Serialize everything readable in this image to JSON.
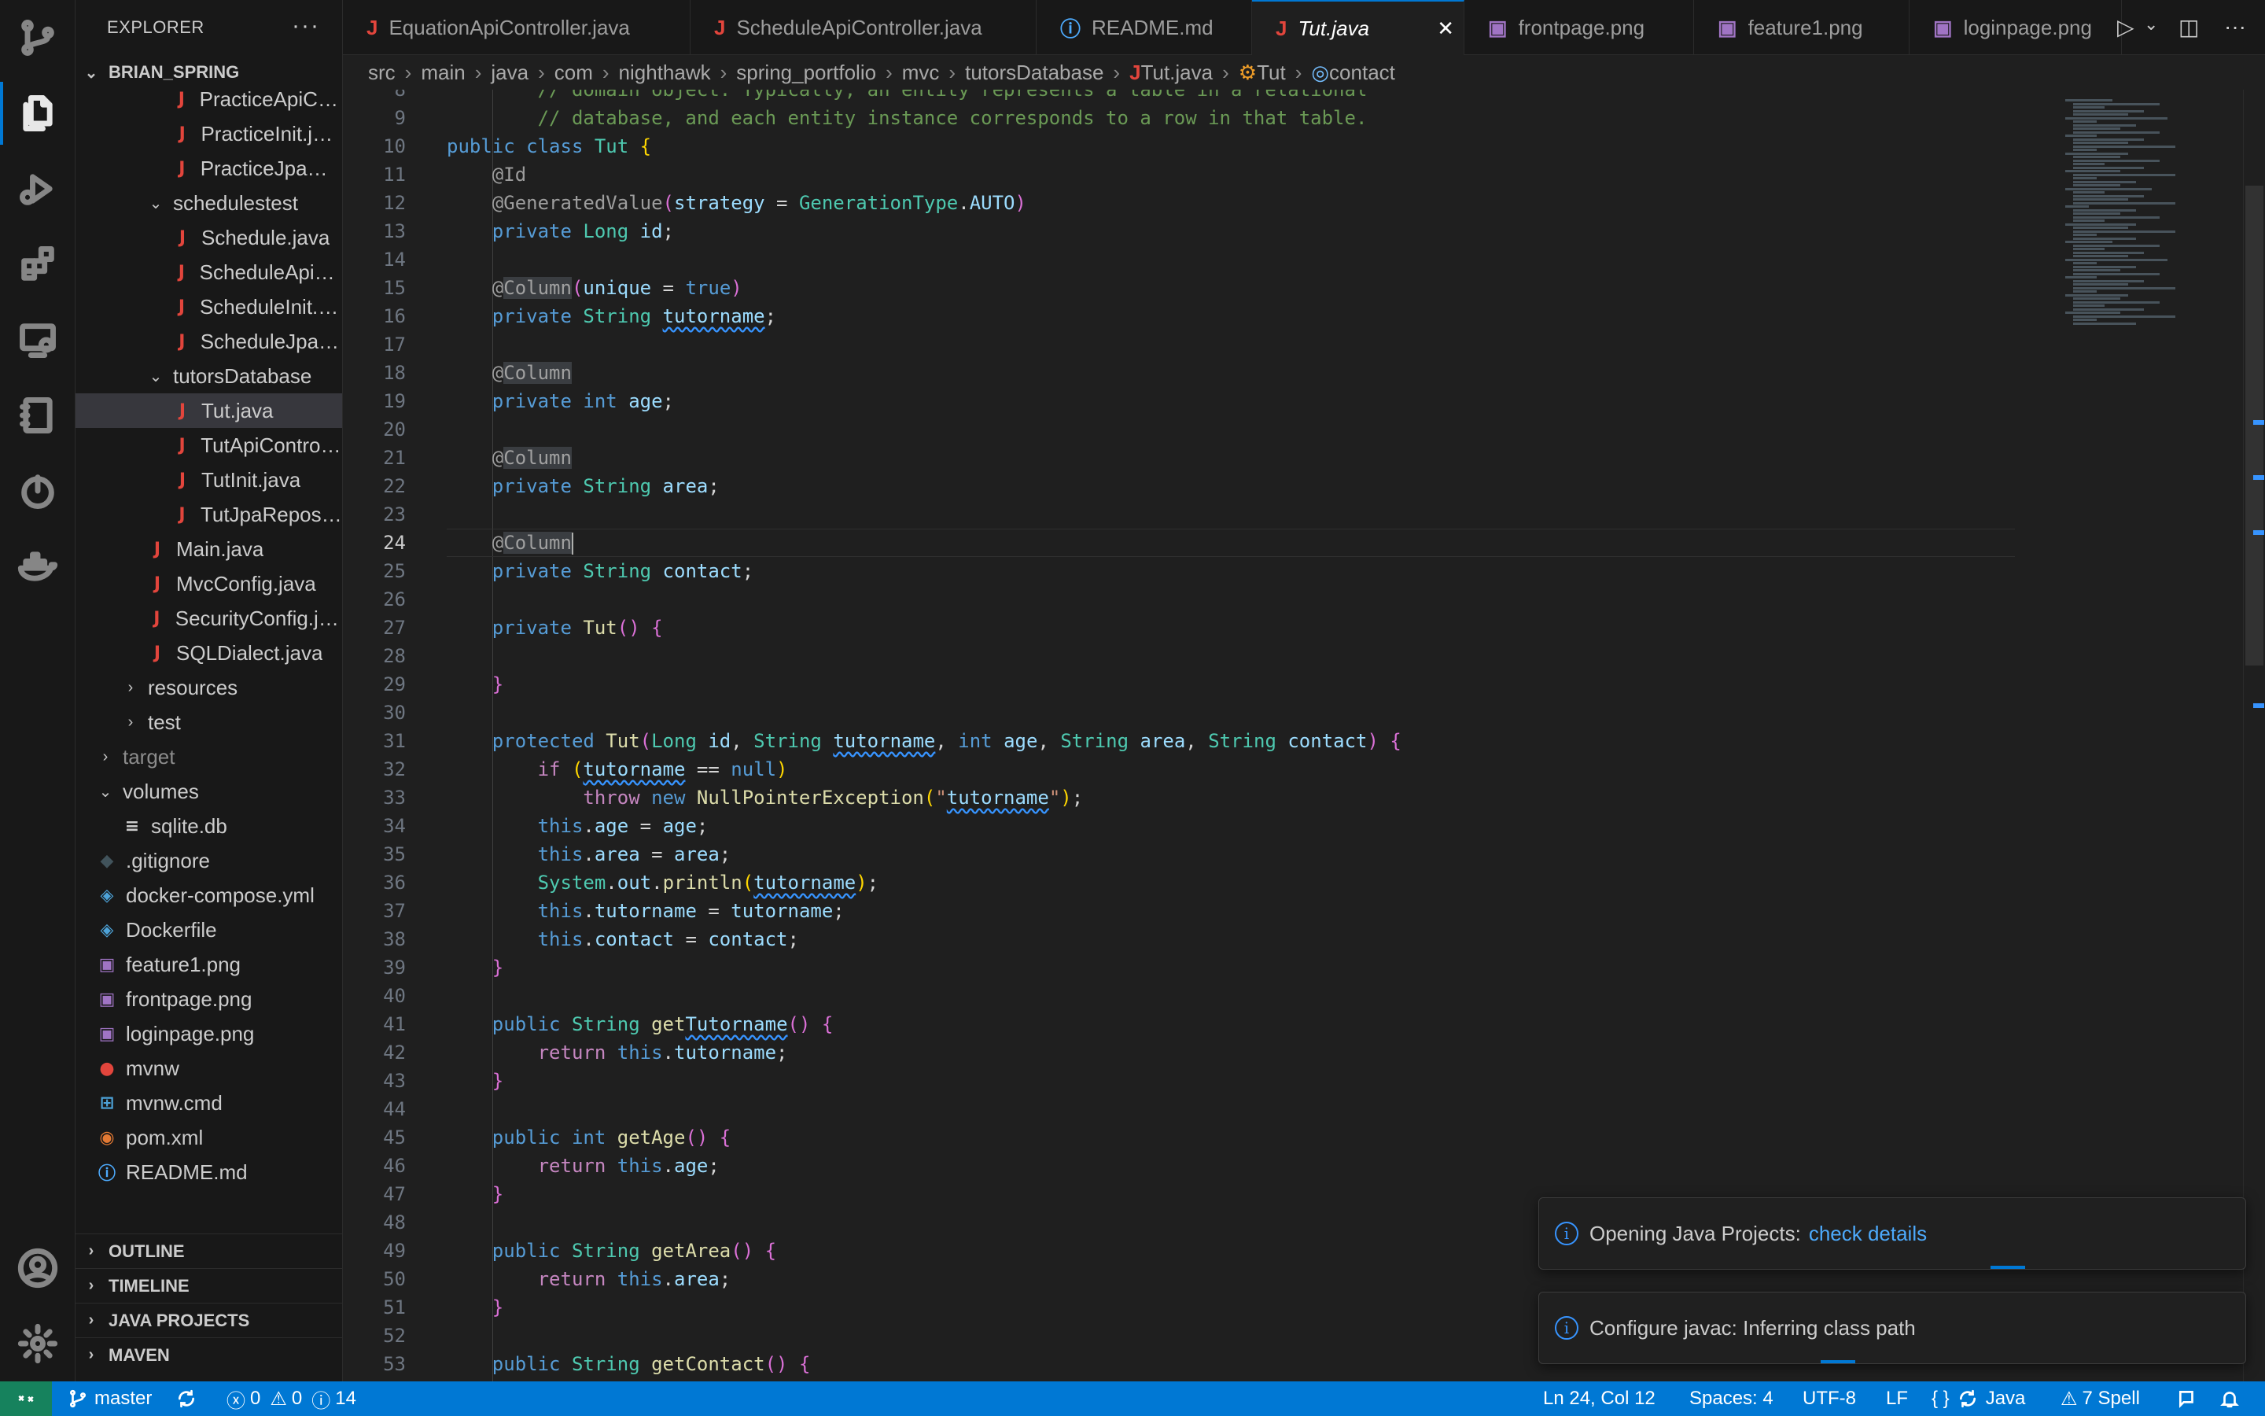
{
  "sidebar": {
    "title": "EXPLORER",
    "root": "BRIAN_SPRING",
    "items": [
      {
        "label": "PracticeApiCon...",
        "indent": 3,
        "icon": "java",
        "kind": "file"
      },
      {
        "label": "PracticeInit.java",
        "indent": 3,
        "icon": "java",
        "kind": "file"
      },
      {
        "label": "PracticeJpaRe...",
        "indent": 3,
        "icon": "java",
        "kind": "file"
      },
      {
        "label": "schedulestest",
        "indent": 2,
        "icon": "",
        "kind": "folder-open"
      },
      {
        "label": "Schedule.java",
        "indent": 3,
        "icon": "java",
        "kind": "file"
      },
      {
        "label": "ScheduleApiCo...",
        "indent": 3,
        "icon": "java",
        "kind": "file"
      },
      {
        "label": "ScheduleInit.java",
        "indent": 3,
        "icon": "java",
        "kind": "file"
      },
      {
        "label": "ScheduleJpaR...",
        "indent": 3,
        "icon": "java",
        "kind": "file"
      },
      {
        "label": "tutorsDatabase",
        "indent": 2,
        "icon": "",
        "kind": "folder-open"
      },
      {
        "label": "Tut.java",
        "indent": 3,
        "icon": "java",
        "kind": "file",
        "selected": true
      },
      {
        "label": "TutApiControll...",
        "indent": 3,
        "icon": "java",
        "kind": "file"
      },
      {
        "label": "TutInit.java",
        "indent": 3,
        "icon": "java",
        "kind": "file"
      },
      {
        "label": "TutJpaReposit...",
        "indent": 3,
        "icon": "java",
        "kind": "file"
      },
      {
        "label": "Main.java",
        "indent": 2,
        "icon": "java",
        "kind": "file"
      },
      {
        "label": "MvcConfig.java",
        "indent": 2,
        "icon": "java",
        "kind": "file"
      },
      {
        "label": "SecurityConfig.java",
        "indent": 2,
        "icon": "java",
        "kind": "file"
      },
      {
        "label": "SQLDialect.java",
        "indent": 2,
        "icon": "java",
        "kind": "file"
      },
      {
        "label": "resources",
        "indent": 1,
        "icon": "",
        "kind": "folder-closed"
      },
      {
        "label": "test",
        "indent": 1,
        "icon": "",
        "kind": "folder-closed"
      },
      {
        "label": "target",
        "indent": 0,
        "icon": "",
        "kind": "folder-closed",
        "dim": true
      },
      {
        "label": "volumes",
        "indent": 0,
        "icon": "",
        "kind": "folder-open"
      },
      {
        "label": "sqlite.db",
        "indent": 1,
        "icon": "db",
        "kind": "file"
      },
      {
        "label": ".gitignore",
        "indent": 0,
        "icon": "git",
        "kind": "file"
      },
      {
        "label": "docker-compose.yml",
        "indent": 0,
        "icon": "docker",
        "kind": "file"
      },
      {
        "label": "Dockerfile",
        "indent": 0,
        "icon": "docker",
        "kind": "file"
      },
      {
        "label": "feature1.png",
        "indent": 0,
        "icon": "image",
        "kind": "file"
      },
      {
        "label": "frontpage.png",
        "indent": 0,
        "icon": "image",
        "kind": "file"
      },
      {
        "label": "loginpage.png",
        "indent": 0,
        "icon": "image",
        "kind": "file"
      },
      {
        "label": "mvnw",
        "indent": 0,
        "icon": "pin",
        "kind": "file"
      },
      {
        "label": "mvnw.cmd",
        "indent": 0,
        "icon": "windows",
        "kind": "file"
      },
      {
        "label": "pom.xml",
        "indent": 0,
        "icon": "rss",
        "kind": "file"
      },
      {
        "label": "README.md",
        "indent": 0,
        "icon": "info",
        "kind": "file"
      }
    ],
    "sections": [
      "OUTLINE",
      "TIMELINE",
      "JAVA PROJECTS",
      "MAVEN"
    ]
  },
  "tabs": [
    {
      "label": "EquationApiController.java",
      "icon": "java"
    },
    {
      "label": "ScheduleApiController.java",
      "icon": "java"
    },
    {
      "label": "README.md",
      "icon": "info"
    },
    {
      "label": "Tut.java",
      "icon": "java",
      "active": true
    },
    {
      "label": "frontpage.png",
      "icon": "image"
    },
    {
      "label": "feature1.png",
      "icon": "image"
    },
    {
      "label": "loginpage.png",
      "icon": "image"
    }
  ],
  "breadcrumb": [
    "src",
    "main",
    "java",
    "com",
    "nighthawk",
    "spring_portfolio",
    "mvc",
    "tutorsDatabase",
    "Tut.java",
    "Tut",
    "contact"
  ],
  "editor": {
    "first_line": 8,
    "current_line": 24,
    "lines": [
      [
        [
          "cm",
          "        // domain object. Typically, an entity represents a table in a relational"
        ]
      ],
      [
        [
          "cm",
          "        // database, and each entity instance corresponds to a row in that table."
        ]
      ],
      [
        [
          "kw",
          "public "
        ],
        [
          "kw",
          "class "
        ],
        [
          "ty",
          "Tut "
        ],
        [
          "br",
          "{"
        ]
      ],
      [
        [
          "an",
          "    @Id"
        ]
      ],
      [
        [
          "an",
          "    @GeneratedValue"
        ],
        [
          "br2",
          "("
        ],
        [
          "va",
          "strategy"
        ],
        [
          "pu",
          " = "
        ],
        [
          "ty",
          "GenerationType"
        ],
        [
          "pu",
          "."
        ],
        [
          "va",
          "AUTO"
        ],
        [
          "br2",
          ")"
        ]
      ],
      [
        [
          "kw",
          "    private "
        ],
        [
          "ty",
          "Long "
        ],
        [
          "va",
          "id"
        ],
        [
          "pu",
          ";"
        ]
      ],
      [
        [
          "pu",
          ""
        ]
      ],
      [
        [
          "an",
          "    @"
        ],
        [
          "anh",
          "Column"
        ],
        [
          "br2",
          "("
        ],
        [
          "va",
          "unique"
        ],
        [
          "pu",
          " = "
        ],
        [
          "kw",
          "true"
        ],
        [
          "br2",
          ")"
        ]
      ],
      [
        [
          "kw",
          "    private "
        ],
        [
          "ty",
          "String "
        ],
        [
          "sq",
          "tutorname"
        ],
        [
          "pu",
          ";"
        ]
      ],
      [
        [
          "pu",
          ""
        ]
      ],
      [
        [
          "an",
          "    @"
        ],
        [
          "anh",
          "Column"
        ]
      ],
      [
        [
          "kw",
          "    private "
        ],
        [
          "kw",
          "int "
        ],
        [
          "va",
          "age"
        ],
        [
          "pu",
          ";"
        ]
      ],
      [
        [
          "pu",
          ""
        ]
      ],
      [
        [
          "an",
          "    @"
        ],
        [
          "anh",
          "Column"
        ]
      ],
      [
        [
          "kw",
          "    private "
        ],
        [
          "ty",
          "String "
        ],
        [
          "va",
          "area"
        ],
        [
          "pu",
          ";"
        ]
      ],
      [
        [
          "pu",
          ""
        ]
      ],
      [
        [
          "an",
          "    @"
        ],
        [
          "anh",
          "Column"
        ],
        [
          "caret",
          ""
        ]
      ],
      [
        [
          "kw",
          "    private "
        ],
        [
          "ty",
          "String "
        ],
        [
          "va",
          "contact"
        ],
        [
          "pu",
          ";"
        ]
      ],
      [
        [
          "pu",
          ""
        ]
      ],
      [
        [
          "kw",
          "    private "
        ],
        [
          "fn",
          "Tut"
        ],
        [
          "br2",
          "() "
        ],
        [
          "br2",
          "{"
        ]
      ],
      [
        [
          "pu",
          ""
        ]
      ],
      [
        [
          "br2",
          "    }"
        ]
      ],
      [
        [
          "pu",
          ""
        ]
      ],
      [
        [
          "kw",
          "    protected "
        ],
        [
          "fn",
          "Tut"
        ],
        [
          "br2",
          "("
        ],
        [
          "ty",
          "Long "
        ],
        [
          "va",
          "id"
        ],
        [
          "pu",
          ", "
        ],
        [
          "ty",
          "String "
        ],
        [
          "sq",
          "tutorname"
        ],
        [
          "pu",
          ", "
        ],
        [
          "kw",
          "int "
        ],
        [
          "va",
          "age"
        ],
        [
          "pu",
          ", "
        ],
        [
          "ty",
          "String "
        ],
        [
          "va",
          "area"
        ],
        [
          "pu",
          ", "
        ],
        [
          "ty",
          "String "
        ],
        [
          "va",
          "contact"
        ],
        [
          "br2",
          ") {"
        ]
      ],
      [
        [
          "kc",
          "        if "
        ],
        [
          "br",
          "("
        ],
        [
          "sq",
          "tutorname"
        ],
        [
          "pu",
          " == "
        ],
        [
          "kw",
          "null"
        ],
        [
          "br",
          ")"
        ]
      ],
      [
        [
          "kc",
          "            throw "
        ],
        [
          "kw",
          "new "
        ],
        [
          "fn",
          "NullPointerException"
        ],
        [
          "br",
          "("
        ],
        [
          "st",
          "\""
        ],
        [
          "sq",
          "tutorname"
        ],
        [
          "st",
          "\""
        ],
        [
          "br",
          ")"
        ],
        [
          "pu",
          ";"
        ]
      ],
      [
        [
          "kw",
          "        this"
        ],
        [
          "pu",
          "."
        ],
        [
          "va",
          "age"
        ],
        [
          "pu",
          " = "
        ],
        [
          "va",
          "age"
        ],
        [
          "pu",
          ";"
        ]
      ],
      [
        [
          "kw",
          "        this"
        ],
        [
          "pu",
          "."
        ],
        [
          "va",
          "area"
        ],
        [
          "pu",
          " = "
        ],
        [
          "va",
          "area"
        ],
        [
          "pu",
          ";"
        ]
      ],
      [
        [
          "ty",
          "        System"
        ],
        [
          "pu",
          "."
        ],
        [
          "va",
          "out"
        ],
        [
          "pu",
          "."
        ],
        [
          "fn",
          "println"
        ],
        [
          "br",
          "("
        ],
        [
          "sq",
          "tutorname"
        ],
        [
          "br",
          ")"
        ],
        [
          "pu",
          ";"
        ]
      ],
      [
        [
          "kw",
          "        this"
        ],
        [
          "pu",
          "."
        ],
        [
          "va",
          "tutorname"
        ],
        [
          "pu",
          " = "
        ],
        [
          "va",
          "tutorname"
        ],
        [
          "pu",
          ";"
        ]
      ],
      [
        [
          "kw",
          "        this"
        ],
        [
          "pu",
          "."
        ],
        [
          "va",
          "contact"
        ],
        [
          "pu",
          " = "
        ],
        [
          "va",
          "contact"
        ],
        [
          "pu",
          ";"
        ]
      ],
      [
        [
          "br2",
          "    }"
        ]
      ],
      [
        [
          "pu",
          ""
        ]
      ],
      [
        [
          "kw",
          "    public "
        ],
        [
          "ty",
          "String "
        ],
        [
          "fn",
          "get"
        ],
        [
          "sq",
          "Tutorname"
        ],
        [
          "br2",
          "() {"
        ]
      ],
      [
        [
          "kc",
          "        return "
        ],
        [
          "kw",
          "this"
        ],
        [
          "pu",
          "."
        ],
        [
          "va",
          "tutorname"
        ],
        [
          "pu",
          ";"
        ]
      ],
      [
        [
          "br2",
          "    }"
        ]
      ],
      [
        [
          "pu",
          ""
        ]
      ],
      [
        [
          "kw",
          "    public "
        ],
        [
          "kw",
          "int "
        ],
        [
          "fn",
          "getAge"
        ],
        [
          "br2",
          "() {"
        ]
      ],
      [
        [
          "kc",
          "        return "
        ],
        [
          "kw",
          "this"
        ],
        [
          "pu",
          "."
        ],
        [
          "va",
          "age"
        ],
        [
          "pu",
          ";"
        ]
      ],
      [
        [
          "br2",
          "    }"
        ]
      ],
      [
        [
          "pu",
          ""
        ]
      ],
      [
        [
          "kw",
          "    public "
        ],
        [
          "ty",
          "String "
        ],
        [
          "fn",
          "getArea"
        ],
        [
          "br2",
          "() {"
        ]
      ],
      [
        [
          "kc",
          "        return "
        ],
        [
          "kw",
          "this"
        ],
        [
          "pu",
          "."
        ],
        [
          "va",
          "area"
        ],
        [
          "pu",
          ";"
        ]
      ],
      [
        [
          "br2",
          "    }"
        ]
      ],
      [
        [
          "pu",
          ""
        ]
      ],
      [
        [
          "kw",
          "    public "
        ],
        [
          "ty",
          "String "
        ],
        [
          "fn",
          "getContact"
        ],
        [
          "br2",
          "() {"
        ]
      ]
    ]
  },
  "notifications": [
    {
      "text": "Opening Java Projects:",
      "link": "check details"
    },
    {
      "text": "Configure javac: Inferring class path",
      "link": ""
    }
  ],
  "status": {
    "branch": "master",
    "errors": "0",
    "warnings": "0",
    "infos": "14",
    "position": "Ln 24, Col 12",
    "spaces": "Spaces: 4",
    "encoding": "UTF-8",
    "eol": "LF",
    "language": "Java",
    "spell": "7 Spell"
  },
  "colors": {
    "accent": "#0078d4",
    "status_bar": "#0078d4",
    "java_icon": "#e2453c",
    "remote": "#16825d"
  }
}
